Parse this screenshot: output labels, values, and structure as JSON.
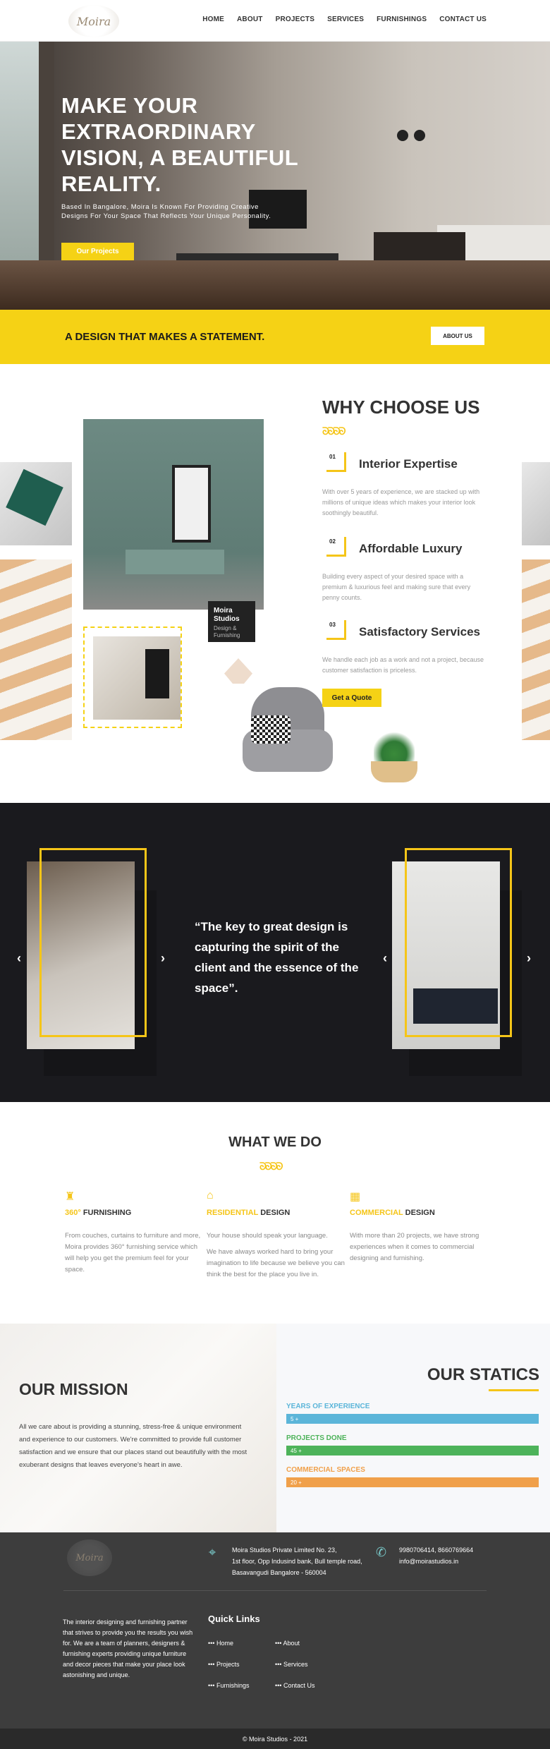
{
  "nav": {
    "logo_text": "Moira",
    "items": [
      "HOME",
      "ABOUT",
      "PROJECTS",
      "SERVICES",
      "FURNISHINGS",
      "CONTACT US"
    ]
  },
  "hero": {
    "title": "MAKE YOUR EXTRAORDINARY VISION, A BEAUTIFUL REALITY.",
    "subtitle": "Based In Bangalore, Moira Is Known For Providing Creative Designs For Your Space That Reflects Your Unique Personality.",
    "cta": "Our Projects"
  },
  "banner": {
    "text": "A DESIGN THAT MAKES A STATEMENT.",
    "button": "ABOUT US"
  },
  "why": {
    "title": "WHY CHOOSE US",
    "features": [
      {
        "num": "01",
        "title": "Interior Expertise",
        "text": "With over 5 years of experience, we are stacked up with millions of unique ideas which makes your interior look soothingly beautiful."
      },
      {
        "num": "02",
        "title": "Affordable Luxury",
        "text": "Building every aspect of your desired space with a premium & luxurious feel and making sure that every penny counts."
      },
      {
        "num": "03",
        "title": "Satisfactory Services",
        "text": "We handle each job as a work and not a project, because customer satisfaction is priceless."
      }
    ],
    "cta": "Get a Quote",
    "badge_title": "Moira Studios",
    "badge_sub": "Design & Furnishing"
  },
  "quote": {
    "text": "“The key to great design is capturing the spirit of the client and the essence of the space”."
  },
  "what_we_do": {
    "title": "WHAT WE DO",
    "services": [
      {
        "highlight": "360°",
        "rest": " FURNISHING",
        "text": "From couches, curtains to furniture and more, Moira provides 360° furnishing service which will help you get the premium feel for your space."
      },
      {
        "highlight": "RESIDENTIAL",
        "rest": " DESIGN",
        "text": "Your house should speak your language.",
        "text2": "We have always worked hard to bring your imagination to life because we believe you can think the best for the place you live in."
      },
      {
        "highlight": "COMMERCIAL",
        "rest": " DESIGN",
        "text": "With more than 20 projects, we have strong experiences when it comes to commercial designing and furnishing."
      }
    ]
  },
  "mission": {
    "title": "OUR MISSION",
    "text": "All we care about is providing a stunning, stress-free & unique environment and experience to our customers. We're committed to provide full customer satisfaction and we ensure that our places stand out beautifully with the most exuberant designs that leaves everyone's heart in awe."
  },
  "statics": {
    "title": "OUR STATICS",
    "items": [
      {
        "label": "YEARS OF EXPERIENCE",
        "value": "5 +",
        "color": "#5bb5d9"
      },
      {
        "label": "PROJECTS DONE",
        "value": "45 +",
        "color": "#4db35a"
      },
      {
        "label": "COMMERCIAL SPACES",
        "value": "20 +",
        "color": "#f0a04a"
      }
    ]
  },
  "footer": {
    "logo_text": "Moira",
    "address": [
      "Moira Studios Private Limited No. 23,",
      "1st floor, Opp Indusind bank, Bull temple road,",
      "Basavangudi Bangalore - 560004"
    ],
    "phone": "9980706414, 8660769664",
    "email": "info@moirastudios.in",
    "about": "The interior designing and furnishing partner that strives to provide you the results you wish for. We are a team of planners, designers & furnishing experts providing unique furniture and decor pieces that make your place look astonishing and unique.",
    "links_title": "Quick Links",
    "links": [
      "Home",
      "About",
      "Projects",
      "Services",
      "Furnishings",
      "Contact Us"
    ],
    "copyright": "© Moira Studios - 2021"
  }
}
